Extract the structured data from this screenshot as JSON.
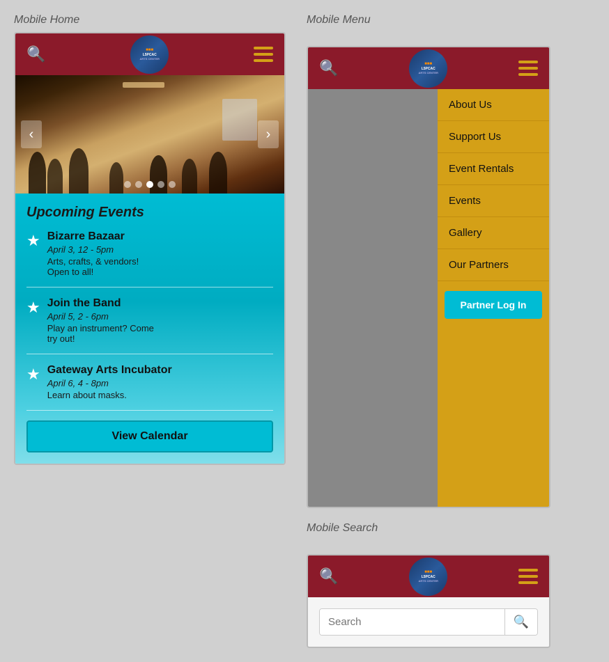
{
  "labels": {
    "mobile_home": "Mobile Home",
    "mobile_menu": "Mobile Menu",
    "mobile_search": "Mobile Search"
  },
  "header": {
    "logo_alt": "L5PCAC Logo"
  },
  "carousel": {
    "dots": [
      false,
      false,
      true,
      false,
      false
    ],
    "left_arrow": "‹",
    "right_arrow": "›"
  },
  "events": {
    "title": "Upcoming Events",
    "items": [
      {
        "name": "Bizarre Bazaar",
        "date": "April 3, 12 - 5pm",
        "desc1": "Arts, crafts, & vendors!",
        "desc2": "Open to all!"
      },
      {
        "name": "Join the Band",
        "date": "April 5, 2 - 6pm",
        "desc1": "Play an instrument? Come",
        "desc2": "try out!"
      },
      {
        "name": "Gateway Arts Incubator",
        "date": "April 6, 4 - 8pm",
        "desc1": "Learn about masks.",
        "desc2": ""
      }
    ],
    "view_calendar": "View Calendar"
  },
  "menu": {
    "items": [
      "About Us",
      "Support Us",
      "Event Rentals",
      "Events",
      "Gallery",
      "Our Partners"
    ],
    "partner_login": "Partner Log In"
  },
  "search": {
    "placeholder": "Search"
  }
}
